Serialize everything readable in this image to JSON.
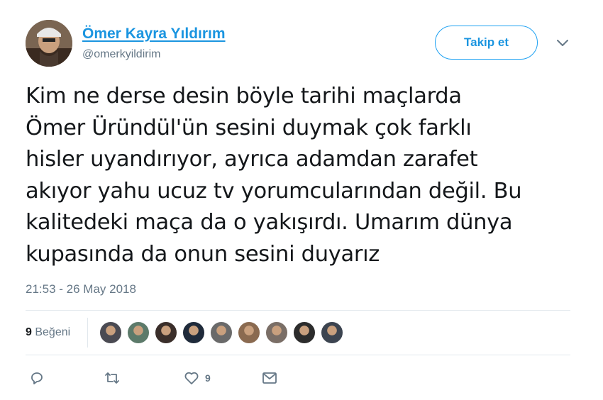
{
  "user": {
    "display_name": "Ömer Kayra Yıldırım",
    "handle": "@omerkyildirim"
  },
  "follow_button_label": "Takip et",
  "tweet": {
    "text": "Kim ne derse desin böyle tarihi maçlarda\nÖmer Üründül'ün sesini duymak çok farklı\nhisler uyandırıyor, ayrıca adamdan zarafet\nakıyor yahu ucuz tv yorumcularından değil. Bu\nkalitedeki maça da o yakışırdı. Umarım dünya\nkupasında da onun sesini duyarız",
    "timestamp": "21:53 - 26 May 2018"
  },
  "likes": {
    "count": "9",
    "label": "Beğeni",
    "likers": [
      {
        "color": "#4a4a52"
      },
      {
        "color": "#5c7a6a"
      },
      {
        "color": "#3a2e2a"
      },
      {
        "color": "#1f2a3a"
      },
      {
        "color": "#6a6a6a"
      },
      {
        "color": "#8a6a50"
      },
      {
        "color": "#7a6e66"
      },
      {
        "color": "#2c2c2c"
      },
      {
        "color": "#3c4450"
      }
    ]
  },
  "actions": {
    "reply_icon": "reply-icon",
    "retweet_icon": "retweet-icon",
    "like_icon": "heart-icon",
    "like_count": "9",
    "dm_icon": "envelope-icon"
  },
  "colors": {
    "accent": "#1da1f2",
    "link": "#1b95e0",
    "muted": "#657786"
  }
}
